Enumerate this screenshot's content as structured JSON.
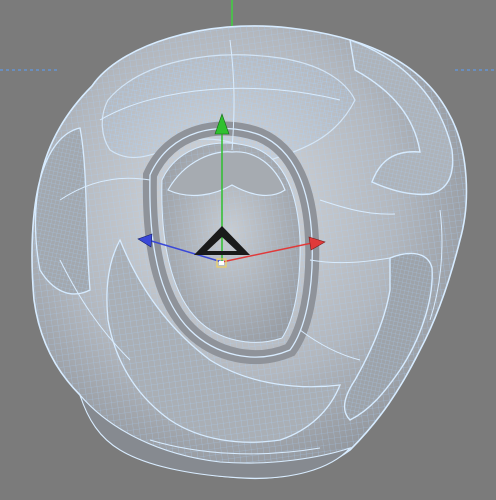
{
  "viewport": {
    "background": "#7b7b7b",
    "world_axis_y_color": "#3fd23f",
    "horizon_line_color": "#5aa0ff"
  },
  "mesh": {
    "shell_color": "#b9bdc2",
    "wire_color": "#a9d3ff",
    "wire_color_light": "#d8ecff",
    "inner_color": "#8c9096"
  },
  "gizmo": {
    "x_axis_color": "#e03a3a",
    "y_axis_color": "#2fc02f",
    "z_axis_color": "#3a48d8",
    "center_color": "#1a1a1a",
    "pivot_color": "#f0d060",
    "x_axis_icon": "arrow-right-icon",
    "y_axis_icon": "arrow-up-icon",
    "z_axis_icon": "arrow-left-icon",
    "center_icon": "triangle-icon"
  }
}
